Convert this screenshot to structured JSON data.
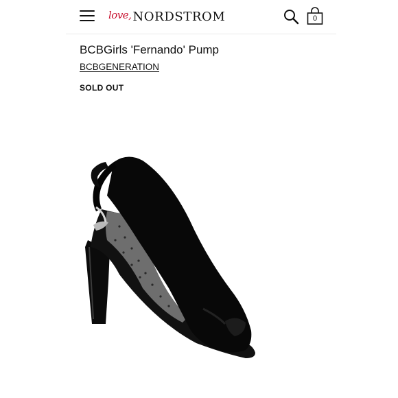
{
  "header": {
    "logo_script": "love,",
    "logo_word": "NORDSTROM",
    "bag_count": "0"
  },
  "product": {
    "title": "BCBGirls 'Fernando' Pump",
    "brand": "BCBGENERATION",
    "status": "SOLD OUT"
  },
  "colors": {
    "accent": "#c8102e",
    "text": "#111111",
    "divider": "#e8e8e8"
  },
  "icons": [
    "menu-icon",
    "search-icon",
    "shopping-bag-icon"
  ]
}
